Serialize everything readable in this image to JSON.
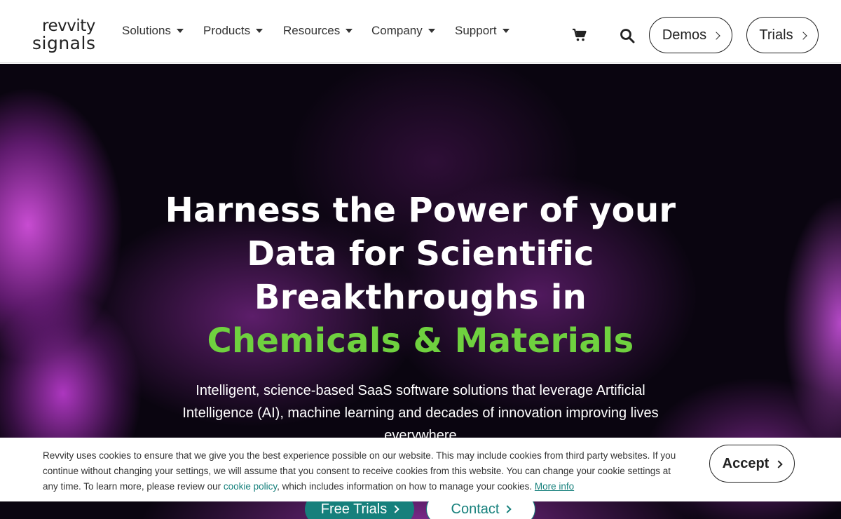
{
  "header": {
    "logo": {
      "line1": "revvity",
      "line2": "signals"
    },
    "nav": [
      {
        "label": "Solutions"
      },
      {
        "label": "Products"
      },
      {
        "label": "Resources"
      },
      {
        "label": "Company"
      },
      {
        "label": "Support"
      }
    ],
    "icons": {
      "cart": "cart-icon",
      "search": "search-icon"
    },
    "demos_label": "Demos",
    "trials_label": "Trials"
  },
  "hero": {
    "title_lines": [
      "Harness the Power of your",
      "Data for Scientific",
      "Breakthroughs in"
    ],
    "title_accent": "Chemicals & Materials",
    "subtitle_lines": [
      "Intelligent, science-based SaaS software solutions that leverage Artificial",
      "Intelligence (AI), machine learning and decades of innovation improving lives",
      "everywhere"
    ],
    "cta_free": "Free Trials",
    "cta_contact": "Contact",
    "colors": {
      "accent": "#6fd13f",
      "teal": "#16807c",
      "background": "#0a0510"
    }
  },
  "cookie": {
    "text_1": "Revvity uses cookies to ensure that we give you the best experience possible on our website. This may include cookies from third party websites. If you continue without changing your settings, we will assume that you consent to receive cookies from this website. You can change your cookie settings at any time. To learn more, please review our ",
    "link_policy": "cookie policy",
    "text_2": ", which includes information on how to manage your cookies. ",
    "link_more": "More info",
    "accept_label": "Accept"
  }
}
